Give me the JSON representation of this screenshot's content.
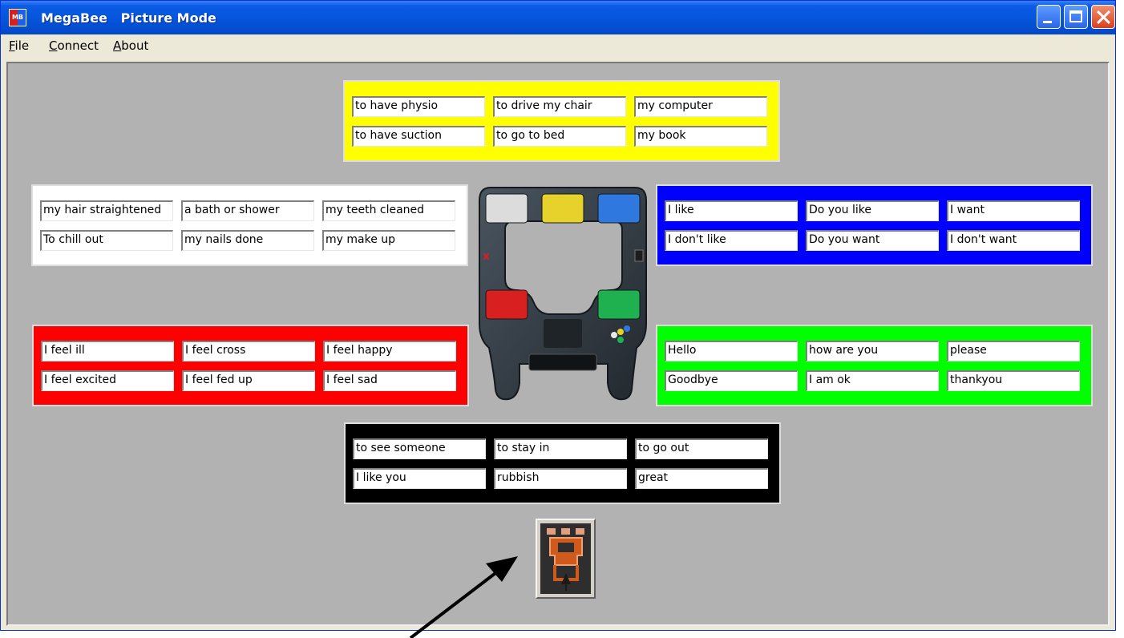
{
  "window": {
    "app_icon_text": "MB",
    "title": "MegaBee   Picture Mode",
    "controls": {
      "minimize": "minimize-icon",
      "maximize": "maximize-icon",
      "close": "close-icon"
    }
  },
  "menu": {
    "file": "File",
    "connect": "Connect",
    "about": "About"
  },
  "panels": {
    "yellow": {
      "color": "#ffff00",
      "rows": [
        [
          "to have physio",
          "to drive my chair",
          "my computer"
        ],
        [
          "to have suction",
          "to go to bed",
          "my book"
        ]
      ]
    },
    "white": {
      "color": "#ffffff",
      "rows": [
        [
          "my hair straightened",
          "a bath or shower",
          "my teeth cleaned"
        ],
        [
          "To chill out",
          "my nails done",
          "my make up"
        ]
      ]
    },
    "blue": {
      "color": "#0000ff",
      "rows": [
        [
          "I like",
          "Do you like",
          "I want"
        ],
        [
          "I don't like",
          "Do you want",
          "I don't want"
        ]
      ]
    },
    "red": {
      "color": "#ff0000",
      "rows": [
        [
          "I feel ill",
          "I feel cross",
          "I feel happy"
        ],
        [
          "I feel excited",
          "I feel fed up",
          "I feel sad"
        ]
      ]
    },
    "green": {
      "color": "#00ff00",
      "rows": [
        [
          "Hello",
          "how are you",
          "please"
        ],
        [
          "Goodbye",
          "I am ok",
          "thankyou"
        ]
      ]
    },
    "black": {
      "color": "#000000",
      "rows": [
        [
          "to see someone",
          "to stay in",
          "to go out"
        ],
        [
          "I like you",
          "rubbish",
          "great"
        ]
      ]
    }
  },
  "device": {
    "icon": "megabee-device-image",
    "pad_colors": {
      "white": "#dcdcdc",
      "yellow": "#e6d22a",
      "blue": "#2f78e0",
      "red": "#d82020",
      "green": "#1fb050"
    }
  },
  "pointer_button": {
    "icon": "megabee-pointer-icon"
  },
  "annotation": {
    "icon": "black-arrow-icon"
  }
}
